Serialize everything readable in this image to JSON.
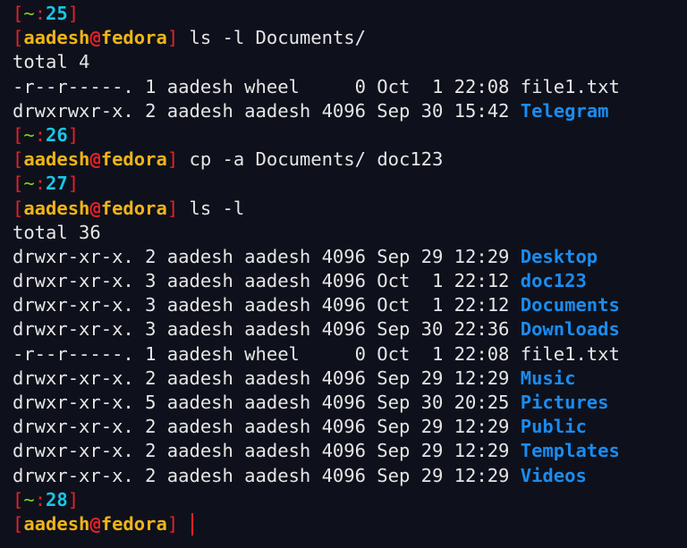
{
  "prompt": {
    "user": "aadesh",
    "host": "fedora",
    "dir": "~"
  },
  "blocks": [
    {
      "num": "25",
      "command": "ls -l Documents/",
      "output": [
        {
          "type": "text",
          "text": "total 4"
        },
        {
          "type": "entry",
          "meta": "-r--r-----. 1 aadesh wheel     0 Oct  1 22:08",
          "name": "file1.txt",
          "kind": "file"
        },
        {
          "type": "entry",
          "meta": "drwxrwxr-x. 2 aadesh aadesh 4096 Sep 30 15:42",
          "name": "Telegram",
          "kind": "dir"
        }
      ]
    },
    {
      "num": "26",
      "command": "cp -a Documents/ doc123",
      "output": []
    },
    {
      "num": "27",
      "command": "ls -l",
      "output": [
        {
          "type": "text",
          "text": "total 36"
        },
        {
          "type": "entry",
          "meta": "drwxr-xr-x. 2 aadesh aadesh 4096 Sep 29 12:29",
          "name": "Desktop",
          "kind": "dir"
        },
        {
          "type": "entry",
          "meta": "drwxr-xr-x. 3 aadesh aadesh 4096 Oct  1 22:12",
          "name": "doc123",
          "kind": "dir"
        },
        {
          "type": "entry",
          "meta": "drwxr-xr-x. 3 aadesh aadesh 4096 Oct  1 22:12",
          "name": "Documents",
          "kind": "dir"
        },
        {
          "type": "entry",
          "meta": "drwxr-xr-x. 3 aadesh aadesh 4096 Sep 30 22:36",
          "name": "Downloads",
          "kind": "dir"
        },
        {
          "type": "entry",
          "meta": "-r--r-----. 1 aadesh wheel     0 Oct  1 22:08",
          "name": "file1.txt",
          "kind": "file"
        },
        {
          "type": "entry",
          "meta": "drwxr-xr-x. 2 aadesh aadesh 4096 Sep 29 12:29",
          "name": "Music",
          "kind": "dir"
        },
        {
          "type": "entry",
          "meta": "drwxr-xr-x. 5 aadesh aadesh 4096 Sep 30 20:25",
          "name": "Pictures",
          "kind": "dir"
        },
        {
          "type": "entry",
          "meta": "drwxr-xr-x. 2 aadesh aadesh 4096 Sep 29 12:29",
          "name": "Public",
          "kind": "dir"
        },
        {
          "type": "entry",
          "meta": "drwxr-xr-x. 2 aadesh aadesh 4096 Sep 29 12:29",
          "name": "Templates",
          "kind": "dir"
        },
        {
          "type": "entry",
          "meta": "drwxr-xr-x. 2 aadesh aadesh 4096 Sep 29 12:29",
          "name": "Videos",
          "kind": "dir"
        }
      ]
    },
    {
      "num": "28",
      "command": "",
      "output": [],
      "active": true
    }
  ]
}
